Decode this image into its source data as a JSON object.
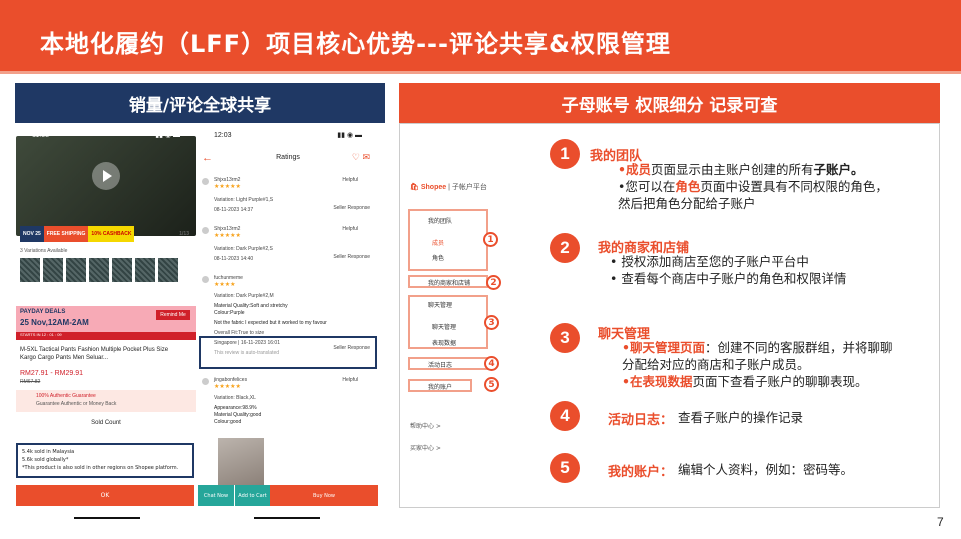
{
  "header": {
    "title": "本地化履约（LFF）项目核心优势---评论共享&权限管理"
  },
  "left_panel": {
    "title": "销量/评论全球共享",
    "phone1": {
      "time": "11:58",
      "badge_nov": "NOV 25",
      "free_ship": "FREE SHIPPING",
      "cashback": "10% CASHBACK",
      "counter": "1/13",
      "variations": "3 Variations Available",
      "payday": "PAYDAY DEALS",
      "payday_date": "25 Nov,12AM-2AM",
      "remind": "Remind Me",
      "starts": "STARTS IN 12 : 01 : 09",
      "product_name": "M-5XL Tactical Pants Fashion Multiple Pocket Plus Size Kargo Cargo Pants Men Seluar...",
      "price": "RM27.91 - RM29.91",
      "old_price": "RM67.82",
      "guarantee": "100% Authentic Guarantee",
      "guarantee_sub": "Guarantee Authentic or Money Back",
      "sold_count": "Sold Count",
      "sold_lines": [
        "5.4k sold in Malaysia",
        "5.6k sold globally*",
        "*This product is also sold in other regions on Shopee platform."
      ],
      "ok": "OK"
    },
    "phone2": {
      "time": "12:03",
      "title": "Ratings",
      "reviews": [
        {
          "user": "Shjxs13rm2",
          "variation": "Variation: Light Purple#1,S",
          "date": "08-11-2023 14:37",
          "helpful": "Helpful",
          "resp": "Seller Response"
        },
        {
          "user": "Shjxs13rm2",
          "variation": "Variation: Dark Purple#2,S",
          "date": "08-11-2023 14:40",
          "helpful": "Helpful",
          "resp": "Seller Response"
        },
        {
          "user": "fuchunmeme",
          "variation": "Variation: Dark Purple#2,M",
          "quality": "Material Quality:Soft and stretchy",
          "colour": "Colour:Purple",
          "text": "Not the fabric I expected but it worked to my favour",
          "fit": "Overall Fit:True to size",
          "location": "Singapore | 16-11-2023 16:01",
          "auto": "This review is auto-translated",
          "resp": "Seller Response"
        },
        {
          "user": "jingabonfelices",
          "variation": "Variation: Black,XL",
          "appearance": "Appearance:98.9%",
          "quality": "Material Quality:good",
          "colour": "Colour:good",
          "helpful": "Helpful"
        }
      ],
      "chat": "Chat Now",
      "cart": "Add to Cart",
      "buy": "Buy Now"
    }
  },
  "right_panel": {
    "title": "子母账号 权限细分 记录可查",
    "shopee_logo": "Shopee",
    "sub_title": "| 子帐户平台",
    "sidebar": [
      "我的团队",
      "成员",
      "角色",
      "我的商家和店铺",
      "聊天管理",
      "聊天管理",
      "表现数据",
      "活动日志",
      "我的账户",
      "帮助中心 >",
      "买家中心 >"
    ],
    "markers": [
      "1",
      "2",
      "3",
      "4",
      "5"
    ],
    "sections": [
      {
        "num": "1",
        "title": "我的团队",
        "lines": [
          [
            "•成员",
            "页面显示由主账户创建的所有",
            "子账户。"
          ],
          [
            "•您可以在",
            "角色",
            "页面中设置具有不同权限的角色，"
          ],
          [
            "然后把角色分配给子账户"
          ]
        ]
      },
      {
        "num": "2",
        "title": "我的商家和店铺",
        "lines": [
          [
            "•  授权添加商店至您的子账户平台中"
          ],
          [
            "•  查看每个商店中子账户的角色和权限详情"
          ]
        ]
      },
      {
        "num": "3",
        "title": "聊天管理",
        "lines": [
          [
            "•聊天管理页面",
            "：创建不同的客服群组，并将聊聊"
          ],
          [
            "分配给对应的商店和子账户成员。"
          ],
          [
            "•在表现数据",
            "页面下查看子账户的聊聊表现。"
          ]
        ]
      },
      {
        "num": "4",
        "title": "活动日志：",
        "body": "查看子账户的操作记录"
      },
      {
        "num": "5",
        "title": "我的账户：",
        "body": "编辑个人资料，例如：密码等。"
      }
    ]
  },
  "page_number": "7",
  "colors": {
    "brand": "#ea4e2c",
    "navy": "#1f3864"
  }
}
